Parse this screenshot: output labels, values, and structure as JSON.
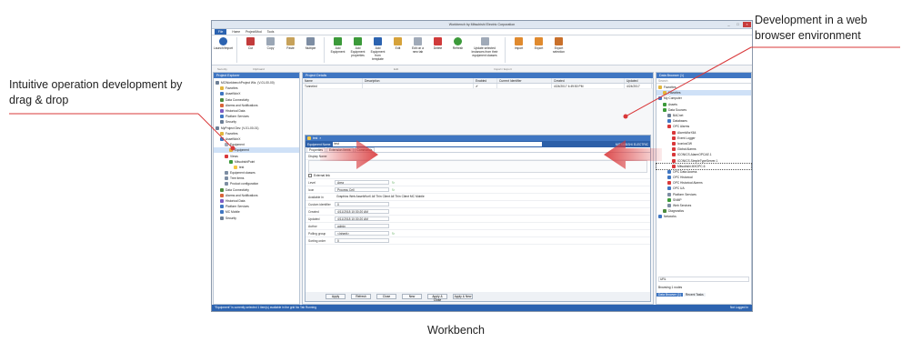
{
  "callouts": {
    "left": "Intuitive operation development by drag & drop",
    "right": "Development in a web browser environment",
    "caption": "Workbench"
  },
  "window": {
    "title": "Workbench by Mitsubishi Electric Corporation",
    "menu": [
      "File",
      "Home",
      "Project/Mod",
      "Tools"
    ],
    "ribbon_buttons": [
      "Launch/Import",
      "Cut",
      "Copy",
      "Paste",
      "Multiple",
      "Add Equipment",
      "Add Equipment properties",
      "Add Equipment from template",
      "Edit",
      "Edit on a new tab",
      "Delete",
      "Refresh",
      "Update selected Instances from their equipment classes",
      "Import",
      "Export",
      "Export selection"
    ],
    "ribbon_groups": [
      "Security",
      "Clipboard",
      "Edit",
      "Import / Export"
    ],
    "status": "\"Equipment\" is currently selected   1 item(s) available in the grid   No Tab Running",
    "status_right": "Not Logged In"
  },
  "project_explorer": {
    "title": "Project Explorer",
    "items": [
      "MCWorkbenchProject Wiz. (V-01-00-00)",
      "Favorites",
      "AssetWorX",
      "Data Connectivity",
      "Alarms and Notifications",
      "Historical Data",
      "Platform Services",
      "Security",
      "MyProject Dev. (V-01-00-01)",
      "Favorites",
      "AssetWorX",
      "Equipment",
      "Equipment",
      "Views",
      "MitsubishiPoint",
      "test",
      "Equipment classes",
      "Tree items",
      "Product configuration",
      "Data Connectivity",
      "Alarms and Notifications",
      "Historical Data",
      "Platform Services",
      "MC Mobile",
      "Security"
    ]
  },
  "project_details": {
    "title": "Project Details",
    "columns": [
      "Name",
      "Description",
      "Enabled",
      "Current Identifier",
      "Created",
      "Updated"
    ],
    "rows": [
      [
        "Tunneled",
        "",
        "✔",
        "",
        "4/24/2017 4:49:50 PM",
        "4/24/2017"
      ]
    ]
  },
  "editor": {
    "tab": "test",
    "label": "Equipment  Name",
    "value": "test",
    "title_right": "MITSUBISHI ELECTRIC",
    "tabs": [
      "Properties",
      "Extension Items",
      "Commands"
    ],
    "display_name_label": "Display Name",
    "external_link_label": "External link",
    "fields": [
      {
        "label": "Level",
        "value": "Area"
      },
      {
        "label": "Icon",
        "value": "Process Cell"
      },
      {
        "label": "Available in",
        "value": "Graphics Web   AssetWorX   All Thin Client   All Thin Client   MC Mobile"
      },
      {
        "label": "Custom identifier",
        "value": "0"
      },
      {
        "label": "Created",
        "value": "4/11/2018 10:30:20 AM"
      },
      {
        "label": "Updated",
        "value": "4/11/2018 10:30:20 AM"
      },
      {
        "label": "Author",
        "value": "admin"
      },
      {
        "label": "Polling group",
        "value": "<Inherit>"
      },
      {
        "label": "Sorting order",
        "value": "0"
      }
    ],
    "buttons": [
      "Apply",
      "Refresh",
      "Close",
      "New",
      "Apply & Close",
      "Apply & New"
    ]
  },
  "data_browser": {
    "title": "Data Browser (1)",
    "search_placeholder": "Search",
    "items": [
      "Favorites",
      "Favorites",
      "My Computer",
      "Assets",
      "Data Sources",
      "BACnet",
      "Databases",
      "OPC Alarms",
      "AlarmWorX64",
      "Event Logger",
      "IconicsGW",
      "Global Alarms",
      "ICONICS.AlarmOPCAE.1",
      "ICONICS.SimpleTypeServer.1",
      "Mitsubishi.MXOPC.6",
      "OPC Data Access",
      "OPC Historical",
      "OPC Historical Alarms",
      "OPC UA",
      "Platform Services",
      "SNMP",
      "Web Services",
      "Diagnostics",
      "Networks"
    ],
    "bottom_label": "URL",
    "bottom_info": "Browsing 1 nodes",
    "bottom_tabs": [
      "Data Browser (1)",
      "Recent Tasks"
    ]
  },
  "colors": {
    "accent": "#3f76c2",
    "arrow": "#d9383a",
    "statusbar": "#2c63b0"
  }
}
